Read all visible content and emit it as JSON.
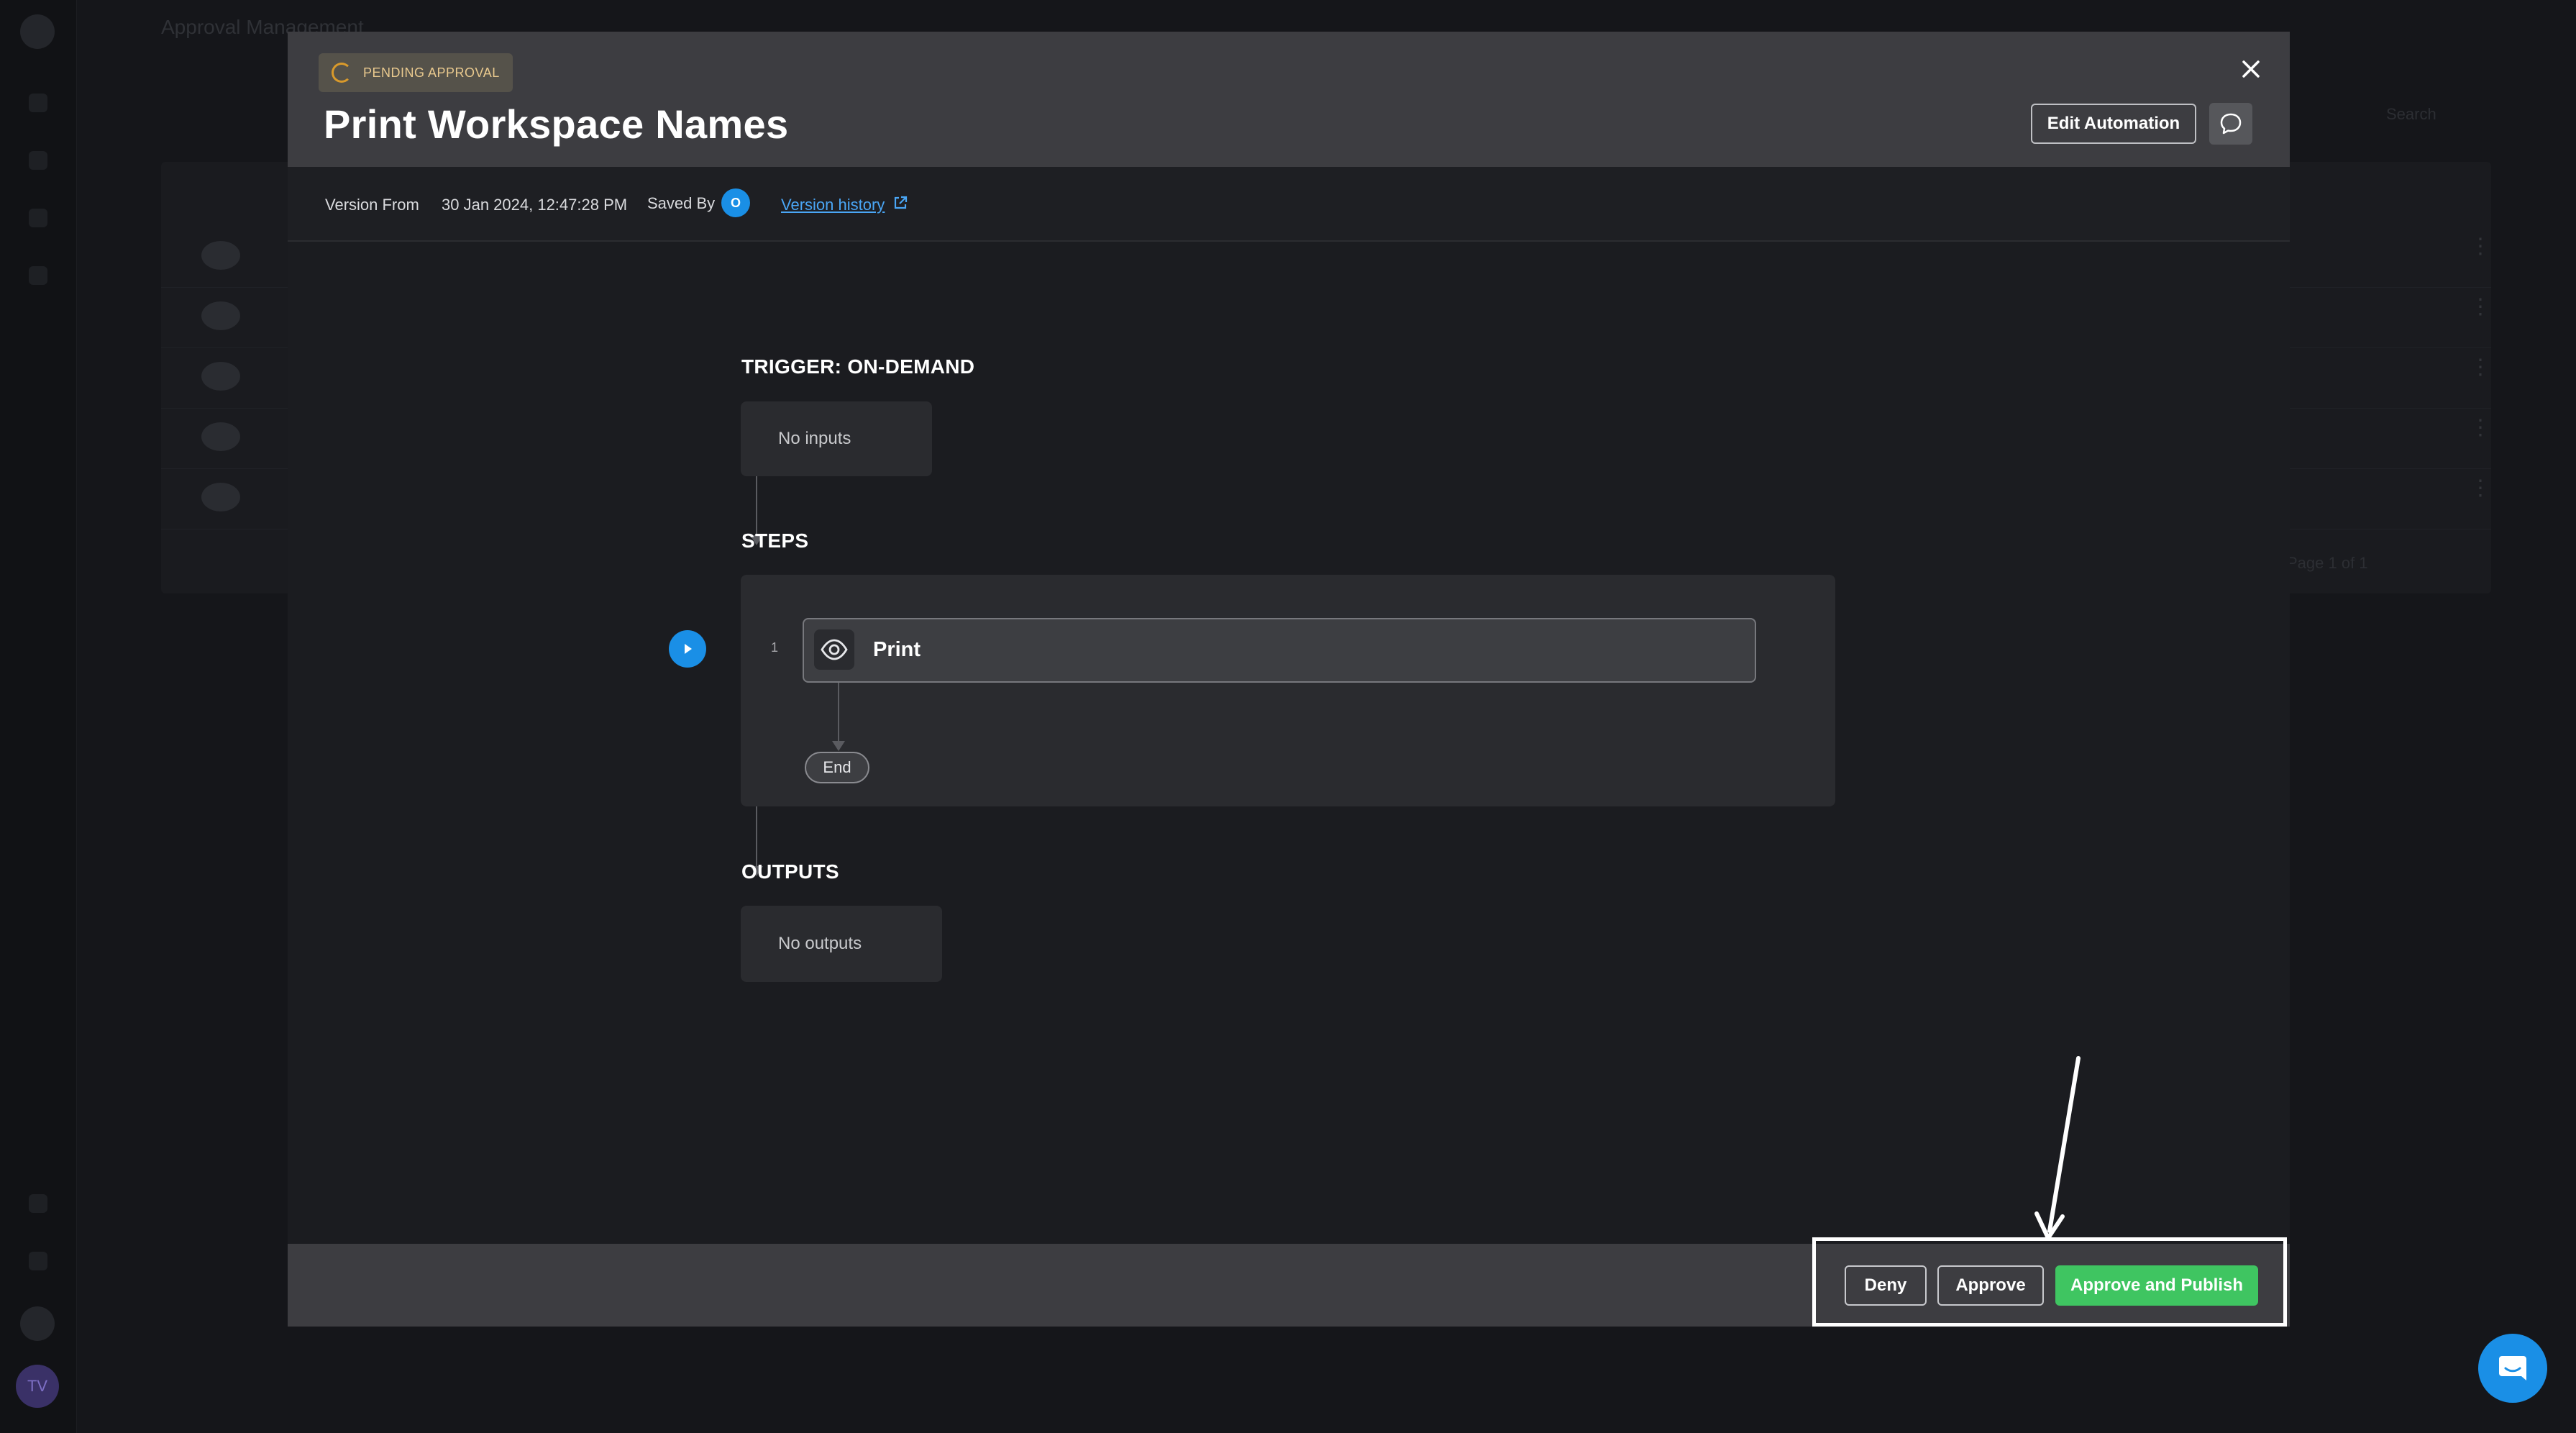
{
  "background": {
    "page_title": "Approval Management",
    "search_label": "Search",
    "pager_text": "Page 1 of 1",
    "rail_avatar_initials": "TV"
  },
  "modal": {
    "status_badge": "PENDING APPROVAL",
    "title": "Print Workspace Names",
    "edit_button_label": "Edit Automation",
    "icons": {
      "close": "close-icon",
      "comment": "comment-icon",
      "external_link": "external-link-icon",
      "play": "play-icon",
      "eye": "eye-icon",
      "chat": "chat-icon",
      "spinner": "spinner-icon"
    },
    "meta": {
      "version_from_label": "Version From",
      "version_date": "30 Jan 2024, 12:47:28 PM",
      "saved_by_label": "Saved By",
      "saved_by_initial": "O",
      "version_history_link": "Version history"
    },
    "flow": {
      "trigger_title": "TRIGGER: ON-DEMAND",
      "trigger_inputs": "No inputs",
      "steps_title": "STEPS",
      "steps": [
        {
          "number": "1",
          "label": "Print"
        }
      ],
      "end_label": "End",
      "outputs_title": "OUTPUTS",
      "outputs_value": "No outputs"
    },
    "footer": {
      "deny_label": "Deny",
      "approve_label": "Approve",
      "approve_publish_label": "Approve and Publish"
    }
  },
  "colors": {
    "accent_blue": "#1a8fe6",
    "approve_green": "#3fc561",
    "pending_orange": "#d99a2b"
  }
}
